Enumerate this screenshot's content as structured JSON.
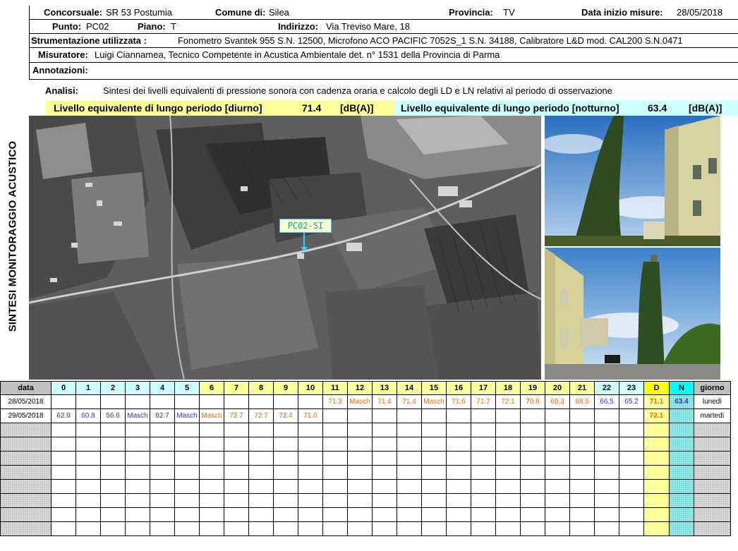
{
  "side_title": "SINTESI MONITORAGGIO ACUSTICO",
  "header": {
    "concorsuale_label": "Concorsuale:",
    "concorsuale_value": "SR 53 Postumia",
    "comune_label": "Comune di:",
    "comune_value": "Silea",
    "provincia_label": "Provincia:",
    "provincia_value": "TV",
    "data_label": "Data inizio misure:",
    "data_value": "28/05/2018",
    "punto_label": "Punto:",
    "punto_value": "PC02",
    "piano_label": "Piano:",
    "piano_value": "T",
    "indirizzo_label": "Indirizzo:",
    "indirizzo_value": "Via Treviso Mare, 18",
    "strumentazione_label": "Strumentazione utilizzata :",
    "strumentazione_value": "Fonometro Svantek 955 S.N. 12500, Microfono ACO PACIFIC 7052S_1 S.N. 34188, Calibratore L&D mod. CAL200 S.N.0471",
    "misuratore_label": "Misuratore:",
    "misuratore_value": "Luigi Ciannamea, Tecnico Competente in Acustica Ambientale det. n° 1531 della Provincia di Parma",
    "annotazioni_label": "Annotazioni:",
    "analisi_label": "Analisi:",
    "analisi_value": "Sintesi dei livelli equivalenti di pressione sonora con cadenza oraria e calcolo degli LD e LN relativi al periodo di osservazione"
  },
  "levels": {
    "diurno_label": "Livello equivalente di lungo periodo [diurno]",
    "diurno_value": "71.4",
    "diurno_unit": "[dB(A)]",
    "notturno_label": "Livello equivalente di lungo periodo [notturno]",
    "notturno_value": "63.4",
    "notturno_unit": "[dB(A)]"
  },
  "map": {
    "point_label": "PC02-SI"
  },
  "colors": {
    "day_value": "#ff6600",
    "night_value": "#3333cc",
    "d_header": "#ffff00",
    "n_header": "#00ffff"
  },
  "table": {
    "headers": [
      "data",
      "0",
      "1",
      "2",
      "3",
      "4",
      "5",
      "6",
      "7",
      "8",
      "9",
      "10",
      "11",
      "12",
      "13",
      "14",
      "15",
      "16",
      "17",
      "18",
      "19",
      "20",
      "21",
      "22",
      "23",
      "D",
      "N",
      "giorno"
    ],
    "rows": [
      [
        "28/05/2018",
        "",
        "",
        "",
        "",
        "",
        "",
        "",
        "",
        "",
        "",
        "",
        "71.3",
        "Masch",
        "71.4",
        "71.4",
        "Masch",
        "71.6",
        "71.7",
        "72.1",
        "70.8",
        "69.3",
        "68.5",
        "66.5",
        "65.2",
        "71.1",
        "63.4",
        "lunedì"
      ],
      [
        "29/05/2018",
        "62.9",
        "60.8",
        "56.6",
        "Masch",
        "62.7",
        "Masch",
        "Masch",
        "72.7",
        "72.7",
        "72.4",
        "71.0",
        "",
        "",
        "",
        "",
        "",
        "",
        "",
        "",
        "",
        "",
        "",
        "",
        "",
        "72.1",
        "",
        "martedì"
      ]
    ],
    "empty_rows": 8
  }
}
